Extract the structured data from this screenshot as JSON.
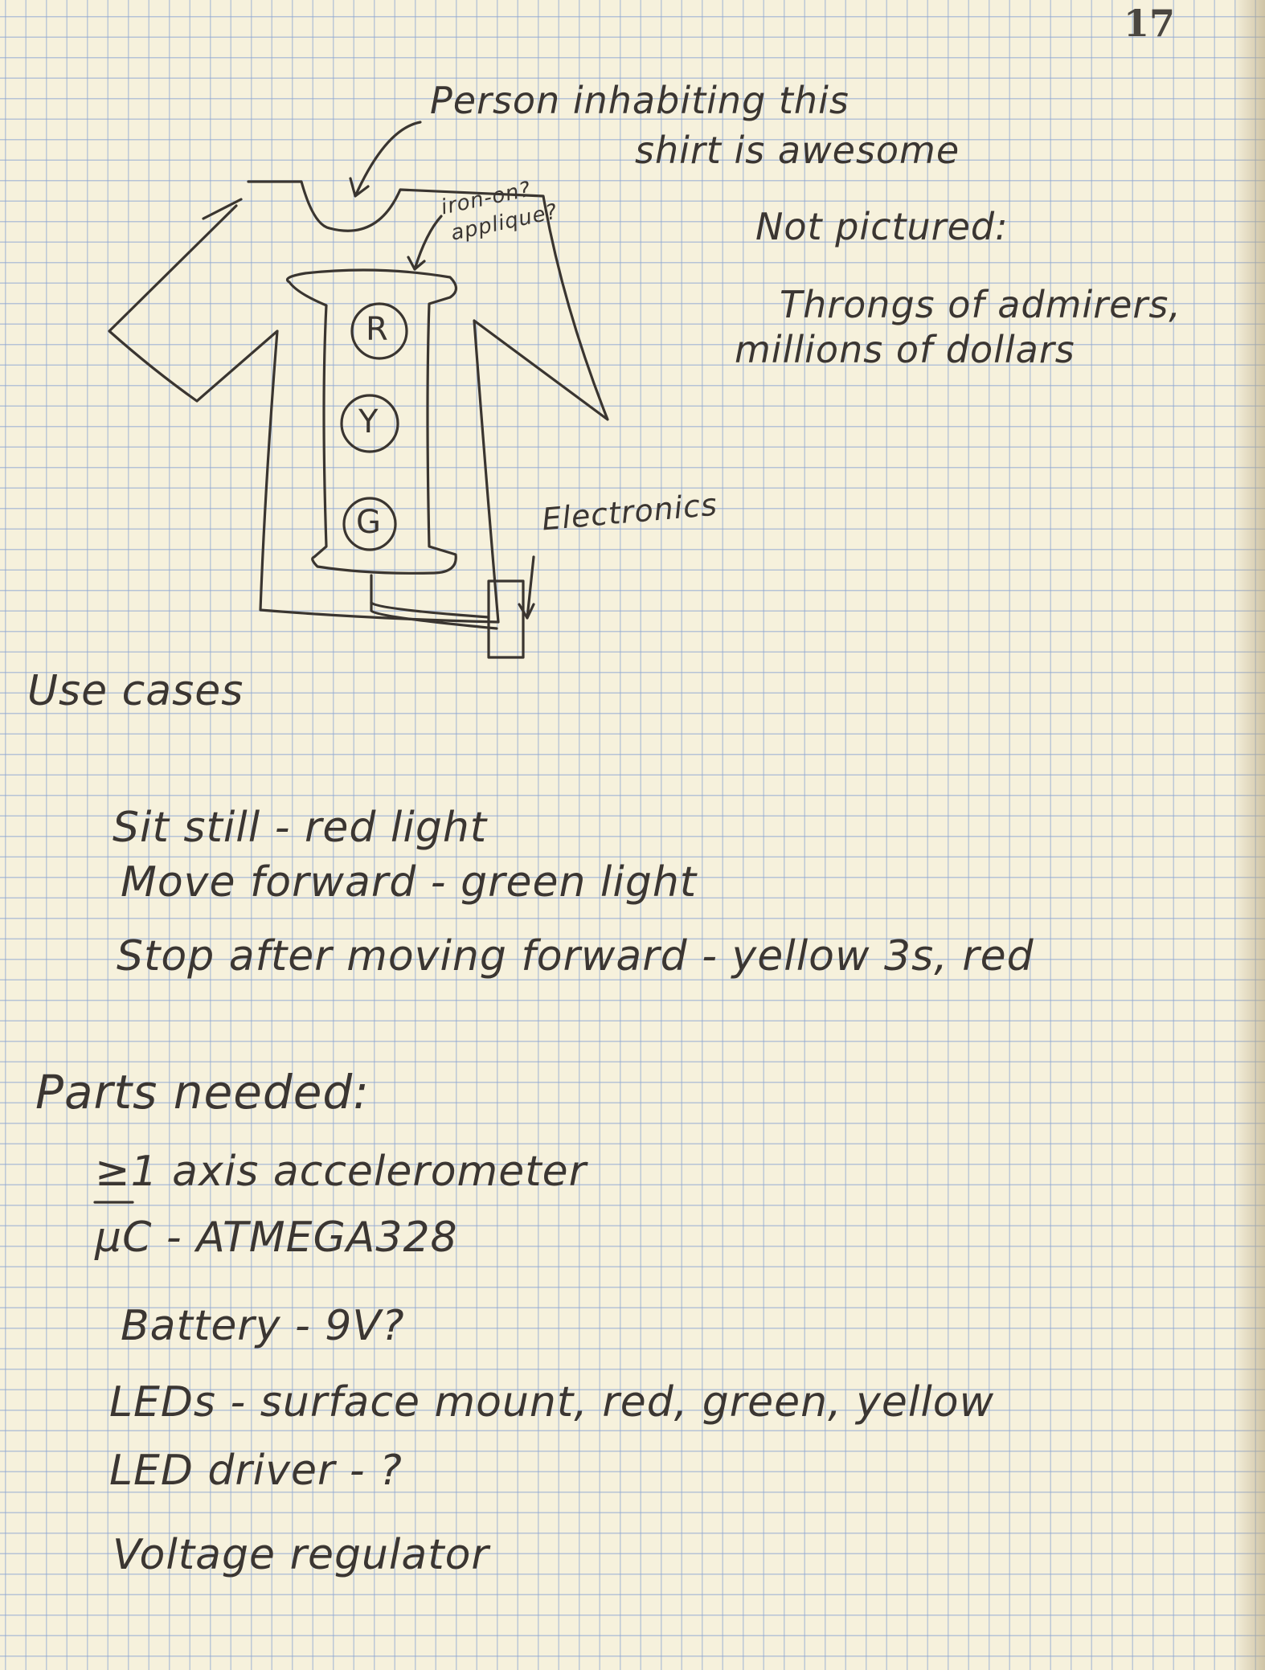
{
  "page_number": "17",
  "sketch": {
    "caption_person": [
      "Person inhabiting this",
      "shirt is awesome"
    ],
    "caption_applique": [
      "iron-on?",
      "applique?"
    ],
    "caption_electronics": "Electronics",
    "light_labels": [
      "R",
      "Y",
      "G"
    ]
  },
  "not_pictured": {
    "heading": "Not pictured:",
    "lines": [
      "Throngs of admirers,",
      "millions of dollars"
    ]
  },
  "use_cases": {
    "heading": "Use cases",
    "items": [
      "Sit still - red light",
      "Move forward - green light",
      "Stop after moving forward - yellow 3s, red"
    ]
  },
  "parts": {
    "heading": "Parts needed:",
    "items": [
      "≥1 axis accelerometer",
      "μC - ATMEGA328",
      "Battery - 9V?",
      "LEDs - surface mount, red, green, yellow",
      "LED driver - ?",
      "Voltage regulator"
    ]
  }
}
